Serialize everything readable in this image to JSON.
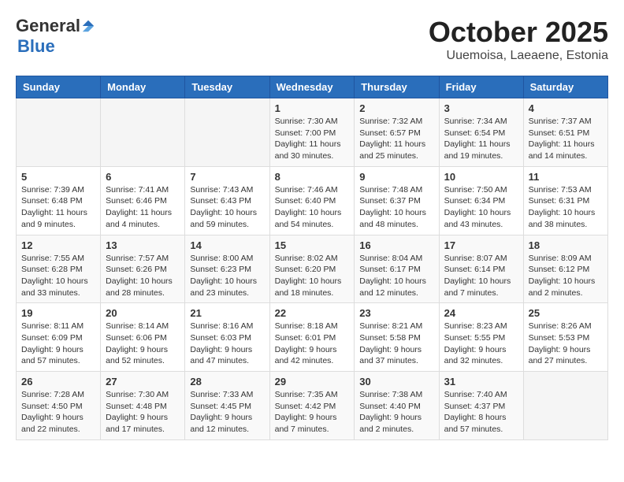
{
  "logo": {
    "general": "General",
    "blue": "Blue"
  },
  "title": "October 2025",
  "subtitle": "Uuemoisa, Laeaene, Estonia",
  "days_of_week": [
    "Sunday",
    "Monday",
    "Tuesday",
    "Wednesday",
    "Thursday",
    "Friday",
    "Saturday"
  ],
  "weeks": [
    [
      {
        "day": "",
        "info": ""
      },
      {
        "day": "",
        "info": ""
      },
      {
        "day": "",
        "info": ""
      },
      {
        "day": "1",
        "info": "Sunrise: 7:30 AM\nSunset: 7:00 PM\nDaylight: 11 hours and 30 minutes."
      },
      {
        "day": "2",
        "info": "Sunrise: 7:32 AM\nSunset: 6:57 PM\nDaylight: 11 hours and 25 minutes."
      },
      {
        "day": "3",
        "info": "Sunrise: 7:34 AM\nSunset: 6:54 PM\nDaylight: 11 hours and 19 minutes."
      },
      {
        "day": "4",
        "info": "Sunrise: 7:37 AM\nSunset: 6:51 PM\nDaylight: 11 hours and 14 minutes."
      }
    ],
    [
      {
        "day": "5",
        "info": "Sunrise: 7:39 AM\nSunset: 6:48 PM\nDaylight: 11 hours and 9 minutes."
      },
      {
        "day": "6",
        "info": "Sunrise: 7:41 AM\nSunset: 6:46 PM\nDaylight: 11 hours and 4 minutes."
      },
      {
        "day": "7",
        "info": "Sunrise: 7:43 AM\nSunset: 6:43 PM\nDaylight: 10 hours and 59 minutes."
      },
      {
        "day": "8",
        "info": "Sunrise: 7:46 AM\nSunset: 6:40 PM\nDaylight: 10 hours and 54 minutes."
      },
      {
        "day": "9",
        "info": "Sunrise: 7:48 AM\nSunset: 6:37 PM\nDaylight: 10 hours and 48 minutes."
      },
      {
        "day": "10",
        "info": "Sunrise: 7:50 AM\nSunset: 6:34 PM\nDaylight: 10 hours and 43 minutes."
      },
      {
        "day": "11",
        "info": "Sunrise: 7:53 AM\nSunset: 6:31 PM\nDaylight: 10 hours and 38 minutes."
      }
    ],
    [
      {
        "day": "12",
        "info": "Sunrise: 7:55 AM\nSunset: 6:28 PM\nDaylight: 10 hours and 33 minutes."
      },
      {
        "day": "13",
        "info": "Sunrise: 7:57 AM\nSunset: 6:26 PM\nDaylight: 10 hours and 28 minutes."
      },
      {
        "day": "14",
        "info": "Sunrise: 8:00 AM\nSunset: 6:23 PM\nDaylight: 10 hours and 23 minutes."
      },
      {
        "day": "15",
        "info": "Sunrise: 8:02 AM\nSunset: 6:20 PM\nDaylight: 10 hours and 18 minutes."
      },
      {
        "day": "16",
        "info": "Sunrise: 8:04 AM\nSunset: 6:17 PM\nDaylight: 10 hours and 12 minutes."
      },
      {
        "day": "17",
        "info": "Sunrise: 8:07 AM\nSunset: 6:14 PM\nDaylight: 10 hours and 7 minutes."
      },
      {
        "day": "18",
        "info": "Sunrise: 8:09 AM\nSunset: 6:12 PM\nDaylight: 10 hours and 2 minutes."
      }
    ],
    [
      {
        "day": "19",
        "info": "Sunrise: 8:11 AM\nSunset: 6:09 PM\nDaylight: 9 hours and 57 minutes."
      },
      {
        "day": "20",
        "info": "Sunrise: 8:14 AM\nSunset: 6:06 PM\nDaylight: 9 hours and 52 minutes."
      },
      {
        "day": "21",
        "info": "Sunrise: 8:16 AM\nSunset: 6:03 PM\nDaylight: 9 hours and 47 minutes."
      },
      {
        "day": "22",
        "info": "Sunrise: 8:18 AM\nSunset: 6:01 PM\nDaylight: 9 hours and 42 minutes."
      },
      {
        "day": "23",
        "info": "Sunrise: 8:21 AM\nSunset: 5:58 PM\nDaylight: 9 hours and 37 minutes."
      },
      {
        "day": "24",
        "info": "Sunrise: 8:23 AM\nSunset: 5:55 PM\nDaylight: 9 hours and 32 minutes."
      },
      {
        "day": "25",
        "info": "Sunrise: 8:26 AM\nSunset: 5:53 PM\nDaylight: 9 hours and 27 minutes."
      }
    ],
    [
      {
        "day": "26",
        "info": "Sunrise: 7:28 AM\nSunset: 4:50 PM\nDaylight: 9 hours and 22 minutes."
      },
      {
        "day": "27",
        "info": "Sunrise: 7:30 AM\nSunset: 4:48 PM\nDaylight: 9 hours and 17 minutes."
      },
      {
        "day": "28",
        "info": "Sunrise: 7:33 AM\nSunset: 4:45 PM\nDaylight: 9 hours and 12 minutes."
      },
      {
        "day": "29",
        "info": "Sunrise: 7:35 AM\nSunset: 4:42 PM\nDaylight: 9 hours and 7 minutes."
      },
      {
        "day": "30",
        "info": "Sunrise: 7:38 AM\nSunset: 4:40 PM\nDaylight: 9 hours and 2 minutes."
      },
      {
        "day": "31",
        "info": "Sunrise: 7:40 AM\nSunset: 4:37 PM\nDaylight: 8 hours and 57 minutes."
      },
      {
        "day": "",
        "info": ""
      }
    ]
  ]
}
